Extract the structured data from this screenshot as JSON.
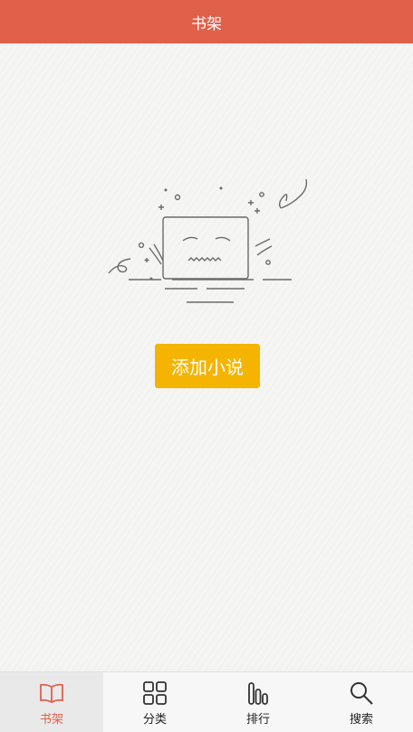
{
  "header": {
    "title": "书架"
  },
  "empty_state": {
    "button_label": "添加小说"
  },
  "tabbar": {
    "items": [
      {
        "label": "书架",
        "icon": "book-icon",
        "active": true
      },
      {
        "label": "分类",
        "icon": "grid-icon",
        "active": false
      },
      {
        "label": "排行",
        "icon": "bar-chart-icon",
        "active": false
      },
      {
        "label": "搜索",
        "icon": "search-icon",
        "active": false
      }
    ]
  },
  "colors": {
    "header_bg": "#e0604a",
    "button_bg": "#f5b400",
    "active_tab": "#e0604a",
    "page_bg": "#f5f5f3"
  }
}
